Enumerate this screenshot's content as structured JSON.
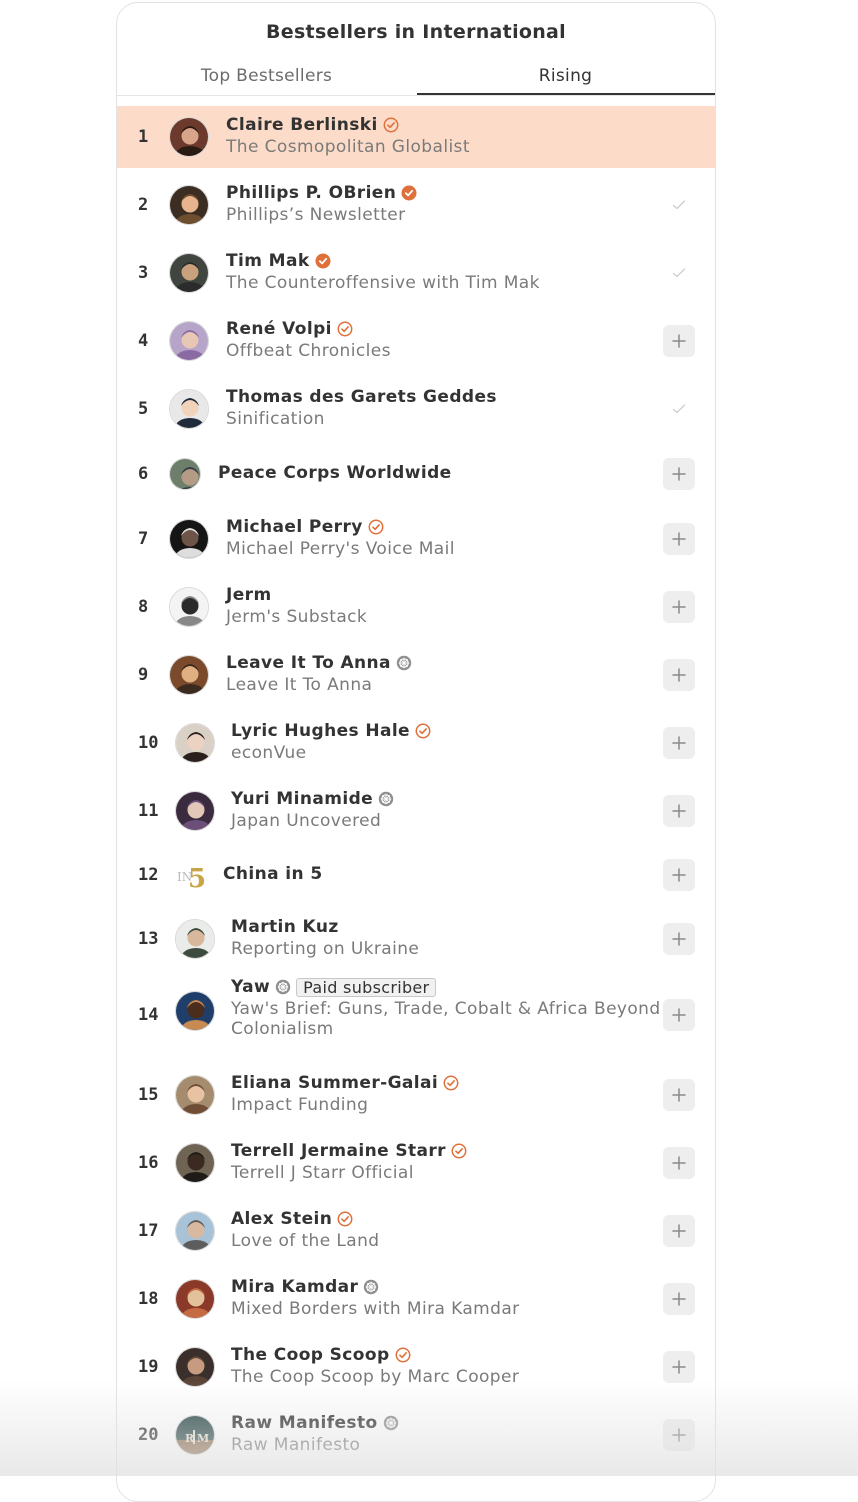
{
  "title": "Bestsellers in International",
  "tabs": [
    {
      "label": "Top Bestsellers",
      "active": false
    },
    {
      "label": "Rising",
      "active": true
    }
  ],
  "colors": {
    "highlight_row": "#fcdcc9",
    "verified_badge": "#e0703a",
    "accent": "#e0703a"
  },
  "rows": [
    {
      "rank": "1",
      "name": "Claire Berlinski",
      "publication": "The Cosmopolitan Globalist",
      "badge": "verified-outline",
      "action": "none",
      "highlighted": true
    },
    {
      "rank": "2",
      "name": "Phillips P. OBrien",
      "publication": "Phillips’s Newsletter",
      "badge": "verified-filled",
      "action": "subscribed-check"
    },
    {
      "rank": "3",
      "name": "Tim Mak",
      "publication": "The Counteroffensive with Tim Mak",
      "badge": "verified-filled",
      "action": "subscribed-check"
    },
    {
      "rank": "4",
      "name": "René Volpi",
      "publication": "Offbeat Chronicles",
      "badge": "verified-outline",
      "action": "subscribe-plus"
    },
    {
      "rank": "5",
      "name": "Thomas des Garets Geddes",
      "publication": "Sinification",
      "badge": "none",
      "action": "subscribed-check"
    },
    {
      "rank": "6",
      "name": "Peace Corps Worldwide",
      "publication": "",
      "badge": "none",
      "action": "subscribe-plus"
    },
    {
      "rank": "7",
      "name": "Michael Perry",
      "publication": "Michael Perry's Voice Mail",
      "badge": "verified-outline",
      "action": "subscribe-plus"
    },
    {
      "rank": "8",
      "name": "Jerm",
      "publication": "Jerm's Substack",
      "badge": "none",
      "action": "subscribe-plus"
    },
    {
      "rank": "9",
      "name": "Leave It To Anna",
      "publication": "Leave It To Anna",
      "badge": "gray-wheel",
      "action": "subscribe-plus"
    },
    {
      "rank": "10",
      "name": "Lyric Hughes Hale",
      "publication": "econVue",
      "badge": "verified-outline",
      "action": "subscribe-plus"
    },
    {
      "rank": "11",
      "name": "Yuri Minamide",
      "publication": "Japan Uncovered",
      "badge": "gray-wheel",
      "action": "subscribe-plus"
    },
    {
      "rank": "12",
      "name": "China in 5",
      "publication": "",
      "badge": "none",
      "action": "subscribe-plus"
    },
    {
      "rank": "13",
      "name": "Martin Kuz",
      "publication": "Reporting on Ukraine",
      "badge": "none",
      "action": "subscribe-plus"
    },
    {
      "rank": "14",
      "name": "Yaw",
      "publication": "Yaw's Brief: Guns, Trade, Cobalt & Africa Beyond Colonialism",
      "badge": "gray-wheel",
      "tag": "Paid subscriber",
      "action": "subscribe-plus"
    },
    {
      "rank": "15",
      "name": "Eliana Summer-Galai",
      "publication": "Impact Funding",
      "badge": "verified-outline",
      "action": "subscribe-plus"
    },
    {
      "rank": "16",
      "name": "Terrell Jermaine Starr",
      "publication": "Terrell J Starr Official",
      "badge": "verified-outline",
      "action": "subscribe-plus"
    },
    {
      "rank": "17",
      "name": "Alex Stein",
      "publication": "Love of the Land",
      "badge": "verified-outline",
      "action": "subscribe-plus"
    },
    {
      "rank": "18",
      "name": "Mira Kamdar",
      "publication": "Mixed Borders with Mira Kamdar",
      "badge": "gray-wheel",
      "action": "subscribe-plus"
    },
    {
      "rank": "19",
      "name": "The Coop Scoop",
      "publication": "The Coop Scoop by Marc Cooper",
      "badge": "verified-outline",
      "action": "subscribe-plus"
    },
    {
      "rank": "20",
      "name": "Raw Manifesto",
      "publication": "Raw Manifesto",
      "badge": "gray-wheel",
      "action": "subscribe-plus"
    }
  ]
}
